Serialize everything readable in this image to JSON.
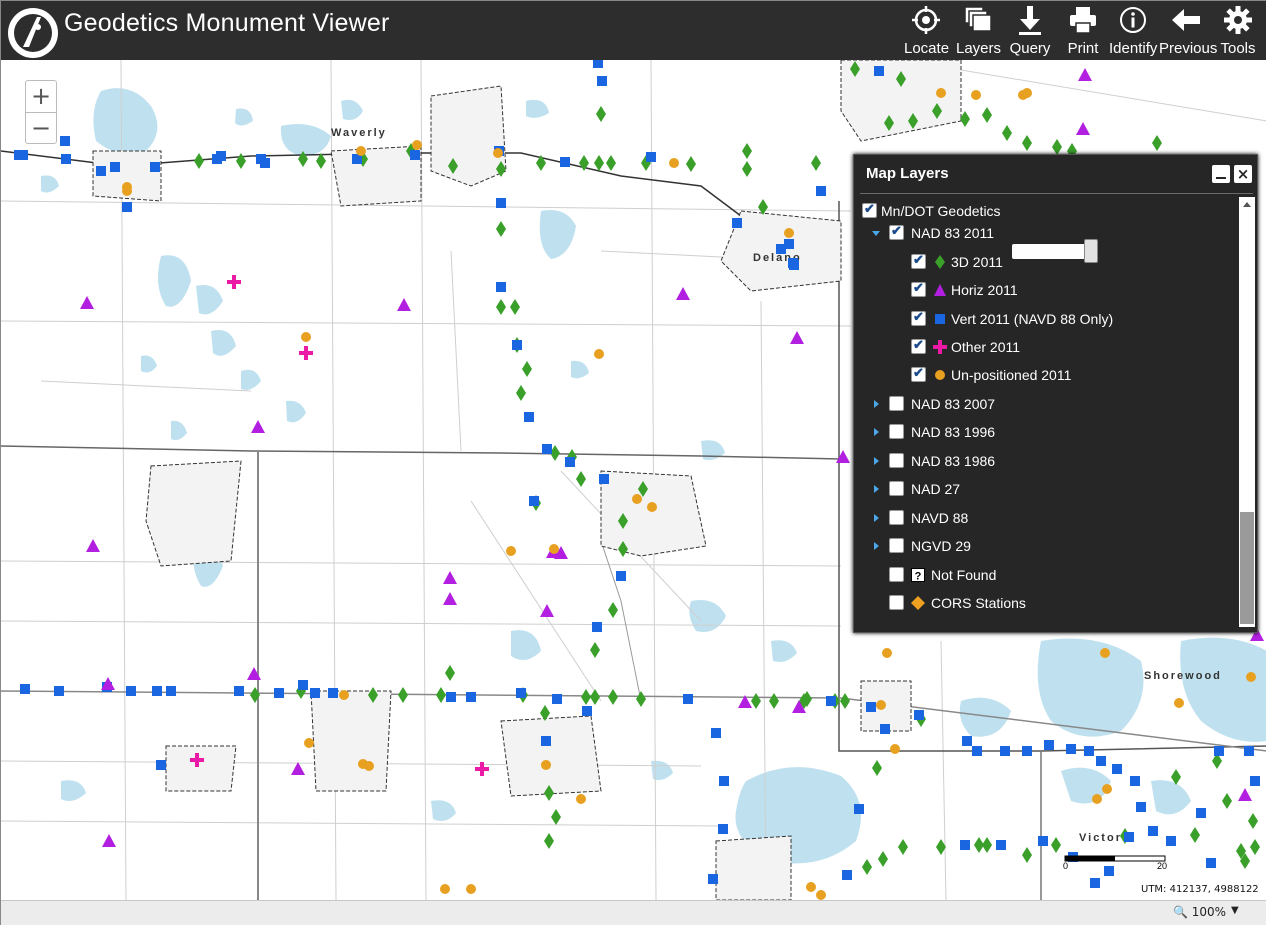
{
  "header": {
    "title": "Geodetics Monument Viewer",
    "tools": [
      {
        "label": "Locate",
        "icon": "locate-icon"
      },
      {
        "label": "Layers",
        "icon": "layers-icon"
      },
      {
        "label": "Query",
        "icon": "download-query-icon"
      },
      {
        "label": "Print",
        "icon": "print-icon"
      },
      {
        "label": "Identify",
        "icon": "info-icon"
      },
      {
        "label": "Previous",
        "icon": "back-arrow-icon"
      },
      {
        "label": "Tools",
        "icon": "gear-icon"
      }
    ]
  },
  "zoom": {
    "in": "+",
    "out": "−"
  },
  "map": {
    "place_labels": [
      "Waverly",
      "Delano",
      "Shorewood",
      "Victoria"
    ],
    "water_color": "#bfe1ef",
    "roads_color": "#c9c9c9",
    "boundary_color": "#555555"
  },
  "panel": {
    "title": "Map Layers",
    "close": "×",
    "root": {
      "label": "Mn/DOT Geodetics",
      "checked": true
    },
    "groups": [
      {
        "label": "NAD 83 2011",
        "expanded": true,
        "checked": true,
        "children": [
          {
            "label": "3D 2011",
            "checked": true,
            "symbol": "green-diamond"
          },
          {
            "label": "Horiz 2011",
            "checked": true,
            "symbol": "purple-triangle"
          },
          {
            "label": "Vert 2011 (NAVD 88 Only)",
            "checked": true,
            "symbol": "blue-square"
          },
          {
            "label": "Other 2011",
            "checked": true,
            "symbol": "magenta-cross"
          },
          {
            "label": "Un-positioned 2011",
            "checked": true,
            "symbol": "orange-circle"
          }
        ]
      },
      {
        "label": "NAD 83 2007",
        "expanded": false,
        "checked": false
      },
      {
        "label": "NAD 83 1996",
        "expanded": false,
        "checked": false
      },
      {
        "label": "NAD 83 1986",
        "expanded": false,
        "checked": false
      },
      {
        "label": "NAD 27",
        "expanded": false,
        "checked": false
      },
      {
        "label": "NAVD 88",
        "expanded": false,
        "checked": false
      },
      {
        "label": "NGVD 29",
        "expanded": false,
        "checked": false
      }
    ],
    "extras": [
      {
        "label": "Not Found",
        "checked": false,
        "symbol": "question-box"
      },
      {
        "label": "CORS Stations",
        "checked": false,
        "symbol": "orange-diamond"
      }
    ]
  },
  "colors": {
    "diamond": "#3aa02a",
    "triangle": "#b21fe0",
    "square": "#1a66e0",
    "cross": "#ea1aa6",
    "circle": "#e8a020",
    "header_bg": "#2d2d2d",
    "panel_bg": "#262626"
  },
  "status": {
    "zoom_level": "100%",
    "utm": "UTM: 412137, 4988122",
    "scale_start": "0",
    "scale_end": "20"
  }
}
